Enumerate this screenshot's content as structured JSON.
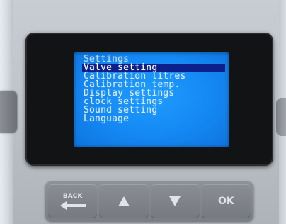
{
  "display": {
    "title": "Settings",
    "items": [
      {
        "label": "Valve setting",
        "selected": true
      },
      {
        "label": "Calibration litres",
        "selected": false
      },
      {
        "label": "Calibration temp.",
        "selected": false
      },
      {
        "label": "Display settings",
        "selected": false
      },
      {
        "label": "clock settings",
        "selected": false
      },
      {
        "label": "Sound setting",
        "selected": false
      },
      {
        "label": "Language",
        "selected": false
      }
    ]
  },
  "keypad": {
    "back_label": "BACK",
    "up_icon": "triangle-up-icon",
    "down_icon": "triangle-down-icon",
    "ok_label": "OK"
  },
  "colors": {
    "screen": "#1488f3",
    "highlight": "#0c1f8a",
    "text": "#d6ebff",
    "bezel": "#121315",
    "keypad": "#7b7f85"
  }
}
